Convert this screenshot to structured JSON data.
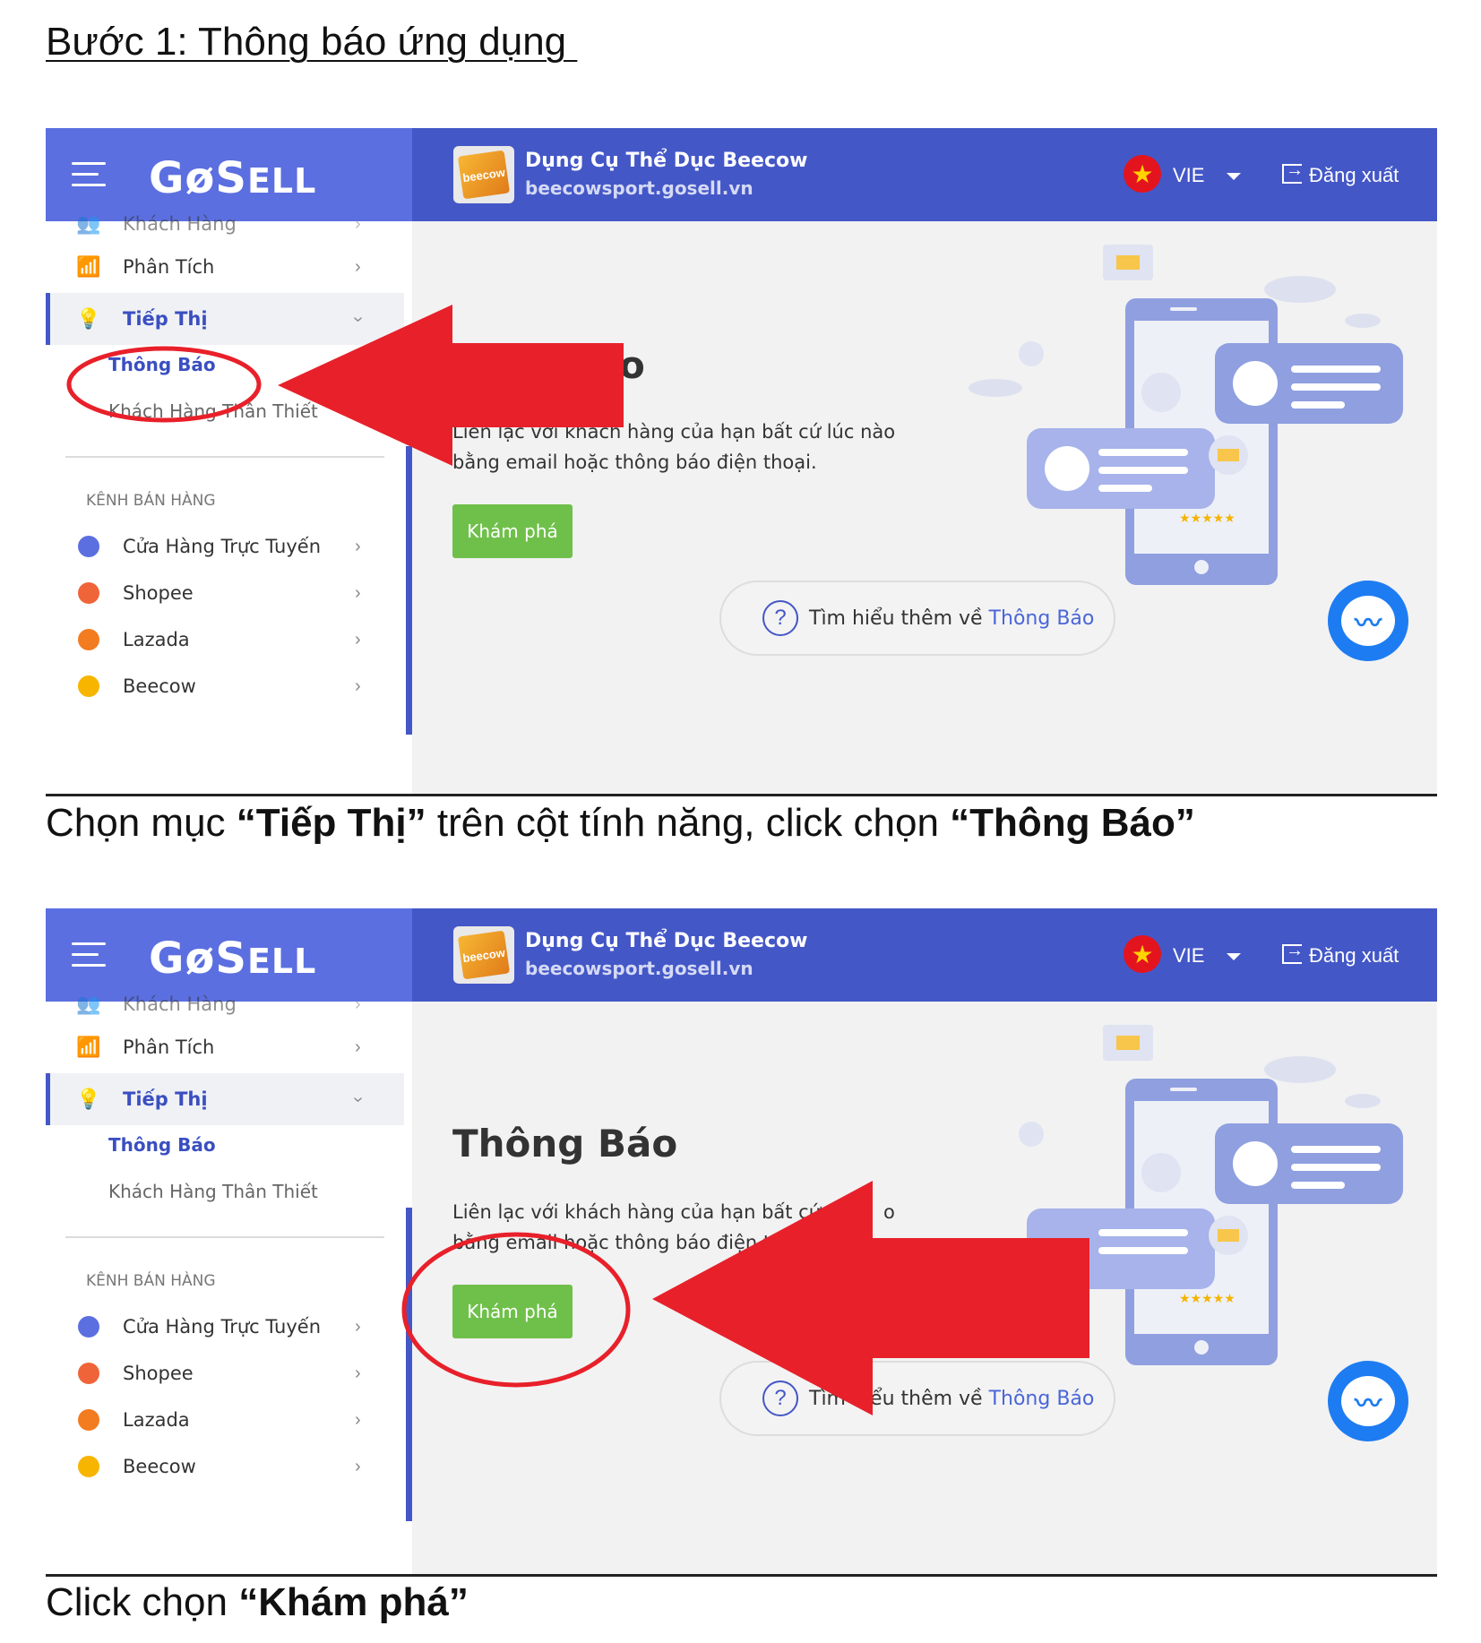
{
  "document": {
    "heading": "Bước 1: Thông báo ứng dụng ",
    "caption_1": {
      "prefix": "Chọn mục ",
      "bold_1": "“Tiếp Thị”",
      "middle": " trên cột tính năng, click chọn ",
      "bold_2": "“Thông Báo”"
    },
    "caption_2": {
      "prefix": "Click chọn ",
      "bold_1": "“Khám phá”"
    }
  },
  "app": {
    "logo_text": "GoSell",
    "shop_logo_text": "beecow",
    "shop_name": "Dụng Cụ Thể Dục Beecow",
    "shop_url": "beecowsport.gosell.vn",
    "language": "VIE",
    "logout_label": "Đăng xuất",
    "sidebar": {
      "cut_item": "Khách Hàng",
      "items": [
        {
          "label": "Phân Tích"
        },
        {
          "label": "Tiếp Thị"
        }
      ],
      "sub_items": [
        "Thông Báo",
        "Khách Hàng Thân Thiết"
      ],
      "section_title": "KÊNH BÁN HÀNG",
      "channels": [
        {
          "label": "Cửa Hàng Trực Tuyến",
          "color": "#5b6fe0"
        },
        {
          "label": "Shopee",
          "color": "#f0643a"
        },
        {
          "label": "Lazada",
          "color": "#f37b20"
        },
        {
          "label": "Beecow",
          "color": "#f7b500"
        }
      ]
    },
    "main": {
      "title": "Thông Báo",
      "title_visible_1": "o",
      "desc_line_1": "Liên lạc với khách hàng của hạn bất cứ lúc nào",
      "desc_line_2": "bằng email hoặc thông báo điện thoại.",
      "desc_line_1_cut": "Liên lạc với khách hàng của hạn bất cứ",
      "desc_line_1_tail": "o",
      "desc_line_2_cut": "bằng email hoặc thông báo điện t",
      "explore_label": "Khám phá",
      "learn_prefix": "Tìm hiểu thêm về ",
      "learn_link": "Thông Báo"
    }
  },
  "colors": {
    "topbar": "#4457c7",
    "brand": "#5b6fe0",
    "accent": "#3a4fc0",
    "explore": "#6fc04a",
    "annotation_red": "#e8202a"
  }
}
